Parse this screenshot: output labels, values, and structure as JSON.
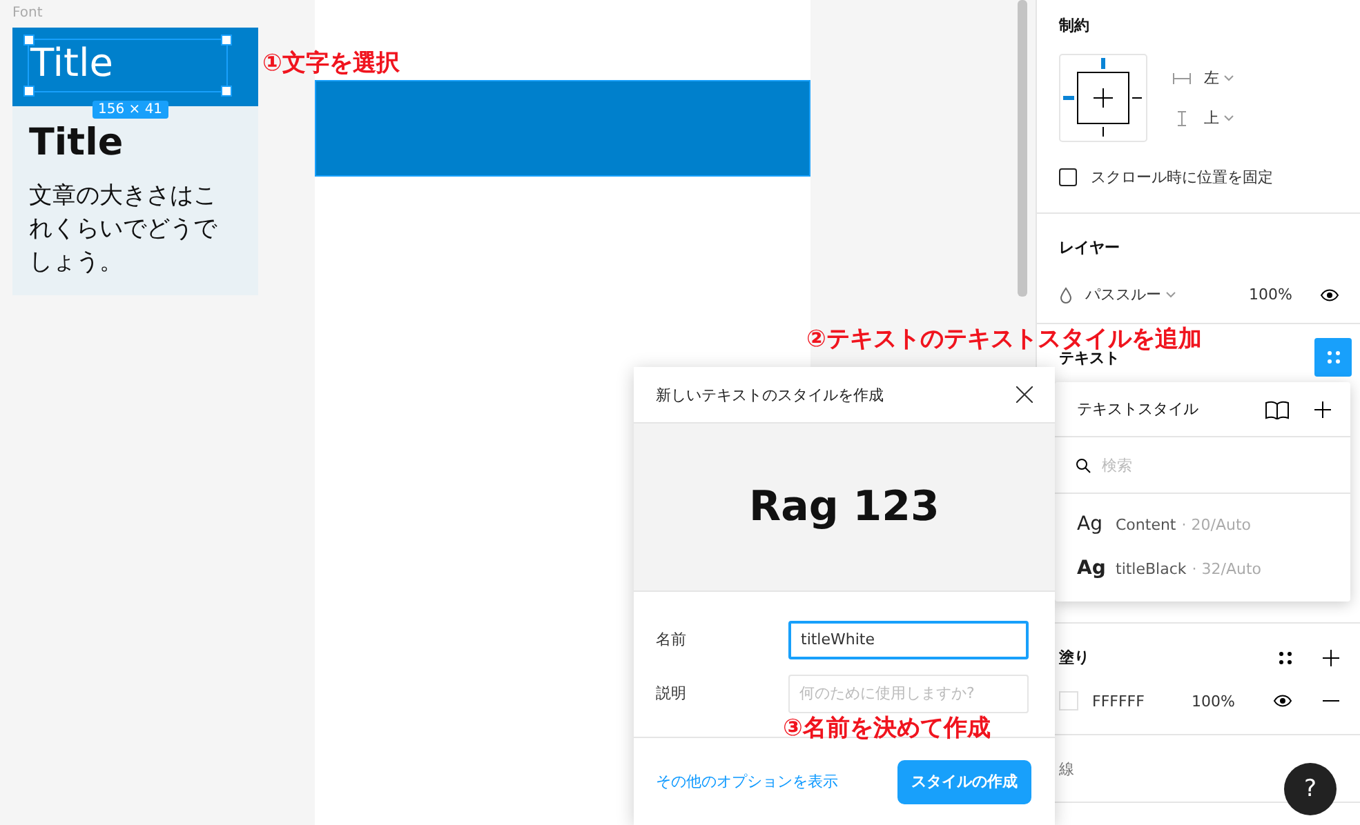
{
  "canvas": {
    "frame_label": "Font",
    "frame": {
      "selected_text": "Title",
      "size_badge": "156 × 41",
      "title": "Title",
      "body": "文章の大きさはこれくらいでどうでしょう。"
    }
  },
  "annotations": [
    "①文字を選択",
    "②テキストのテキストスタイルを追加",
    "③名前を決めて作成"
  ],
  "panel": {
    "constraints": {
      "heading": "制約",
      "horizontal": "左",
      "vertical": "上",
      "fix_on_scroll": {
        "label": "スクロール時に位置を固定",
        "checked": false
      }
    },
    "layer": {
      "heading": "レイヤー",
      "blend": "パススルー",
      "opacity": "100%"
    },
    "text": {
      "heading": "テキスト"
    },
    "fill": {
      "heading": "塗り",
      "items": [
        {
          "hex": "FFFFFF",
          "opacity": "100%"
        }
      ]
    },
    "stroke": {
      "heading": "線"
    }
  },
  "text_styles": {
    "title": "テキストスタイル",
    "search": {
      "placeholder": "検索"
    },
    "styles": [
      {
        "sample": "Ag",
        "name": "Content",
        "detail": "· 20/Auto",
        "bold": false
      },
      {
        "sample": "Ag",
        "name": "titleBlack",
        "detail": "· 32/Auto",
        "bold": true
      }
    ]
  },
  "dialog": {
    "title": "新しいテキストのスタイルを作成",
    "preview": "Rag 123",
    "fields": [
      {
        "label": "名前",
        "value": "titleWhite",
        "focused": true
      },
      {
        "label": "説明",
        "placeholder": "何のために使用しますか?",
        "focused": false
      }
    ],
    "link": "その他のオプションを表示",
    "button": "スタイルの作成"
  },
  "help": "?"
}
